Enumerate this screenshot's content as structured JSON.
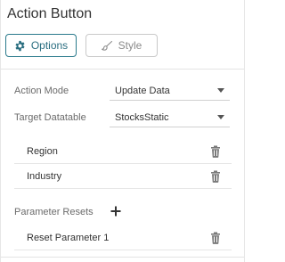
{
  "panel": {
    "title": "Action Button"
  },
  "tabs": [
    {
      "label": "Options",
      "icon": "gear-icon",
      "active": true
    },
    {
      "label": "Style",
      "icon": "brush-icon",
      "active": false
    }
  ],
  "fields": {
    "action_mode": {
      "label": "Action Mode",
      "value": "Update Data"
    },
    "target_datatable": {
      "label": "Target Datatable",
      "value": "StocksStatic"
    }
  },
  "target_items": [
    {
      "label": "Region"
    },
    {
      "label": "Industry"
    }
  ],
  "parameter_resets": {
    "label": "Parameter Resets",
    "items": [
      {
        "label": "Reset Parameter 1"
      }
    ]
  },
  "colors": {
    "accent": "#2a7a8c",
    "text": "#333333",
    "muted": "#6b6b6b"
  }
}
